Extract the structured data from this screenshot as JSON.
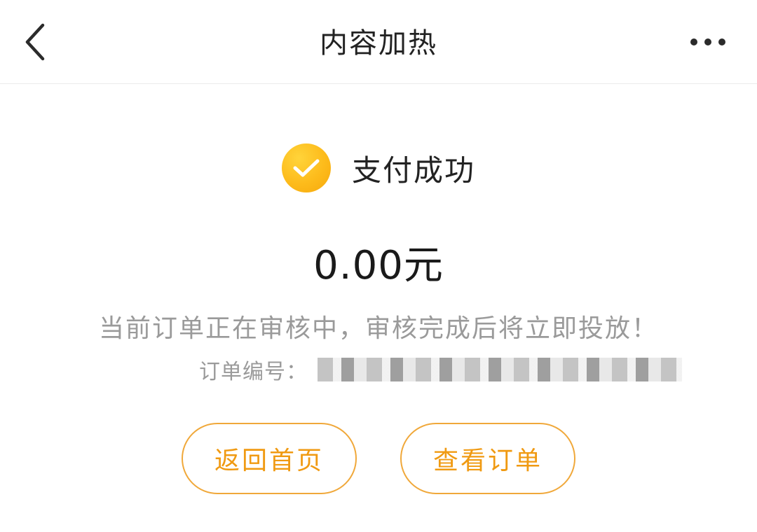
{
  "header": {
    "title": "内容加热",
    "back_icon": "chevron-left-icon",
    "more_icon": "more-horizontal-icon"
  },
  "status": {
    "icon": "check-circle-icon",
    "icon_color": "#FDBB1B",
    "text": "支付成功"
  },
  "payment": {
    "amount": "0.00元"
  },
  "notice": {
    "text": "当前订单正在审核中，审核完成后将立即投放！"
  },
  "order": {
    "label": "订单编号："
  },
  "buttons": {
    "home_label": "返回首页",
    "view_order_label": "查看订单",
    "accent_color": "#F0A83A"
  }
}
